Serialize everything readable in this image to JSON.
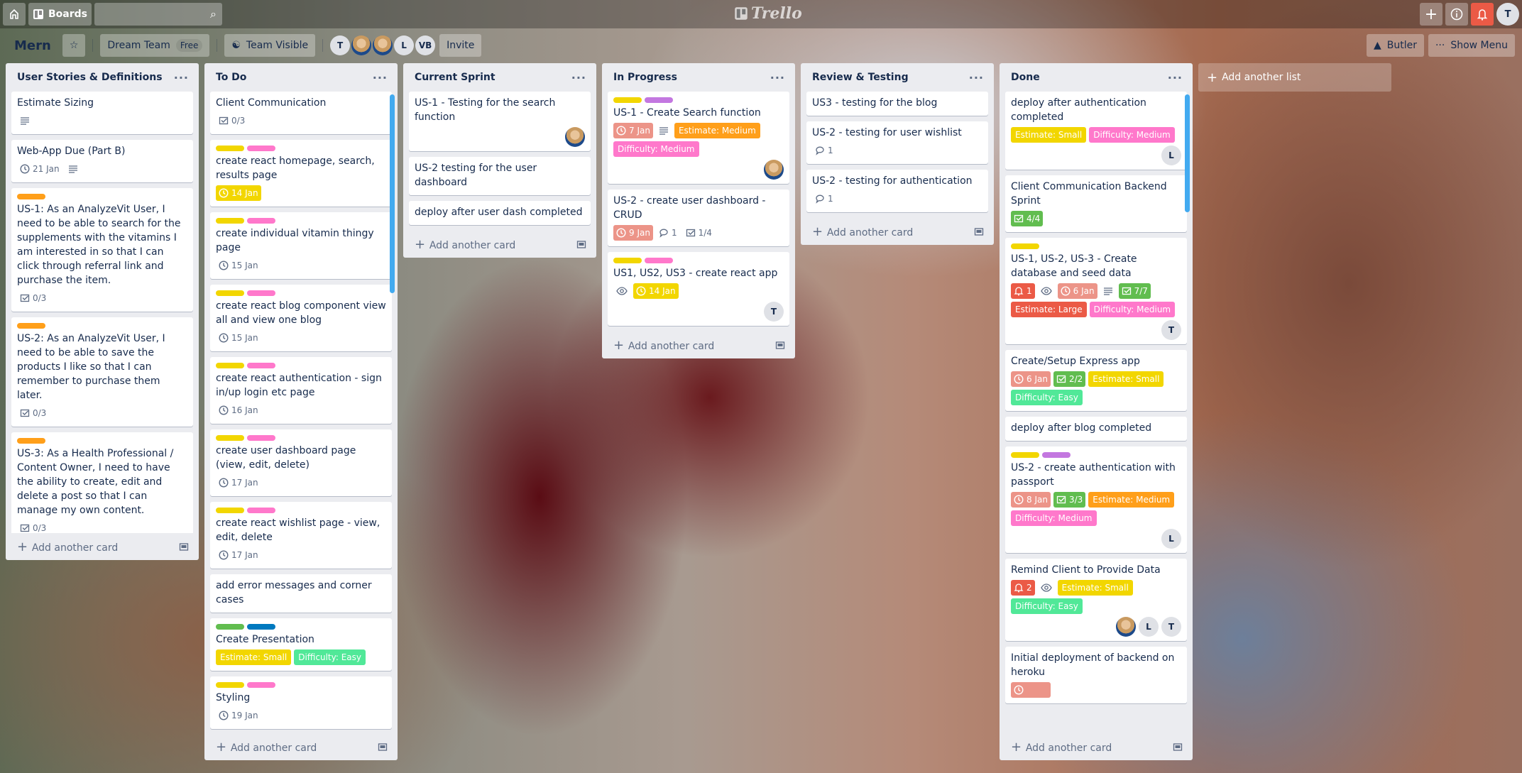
{
  "topbar": {
    "boards_label": "Boards",
    "logo": "Trello",
    "search_placeholder": "",
    "user_initial": "T",
    "icons": [
      "home-icon",
      "boards-icon",
      "search-icon",
      "plus-icon",
      "info-icon",
      "bell-icon"
    ],
    "notification_color": "#eb5a46"
  },
  "board": {
    "title": "Mern",
    "team": "Dream Team",
    "team_plan": "Free",
    "visibility": "Team Visible",
    "members": [
      {
        "initial": "T"
      },
      {
        "photo": true
      },
      {
        "photo": true
      },
      {
        "initial": "L"
      },
      {
        "initial": "VB"
      }
    ],
    "invite": "Invite",
    "butler": "Butler",
    "show_menu": "Show Menu"
  },
  "colors": {
    "yellow": "#f2d600",
    "pink": "#ff78cb",
    "orange": "#ff9f1a",
    "purple": "#c377e0",
    "green": "#61bd4f",
    "blue": "#0079bf",
    "red": "#eb5a46",
    "lime": "#51e898",
    "overdue": "#ec9488"
  },
  "add_card_label": "Add another card",
  "add_list_label": "Add another list",
  "lists": [
    {
      "name": "User Stories & Definitions",
      "cards": [
        {
          "title": "Estimate Sizing",
          "badges": [
            {
              "type": "description"
            }
          ]
        },
        {
          "title": "Web-App Due (Part B)",
          "badges": [
            {
              "type": "due",
              "text": "21 Jan"
            },
            {
              "type": "description"
            }
          ]
        },
        {
          "labels": [
            "orange"
          ],
          "title": "US-1: As an AnalyzeVit User, I need to be able to search for the supplements with the vitamins I am interested in so that I can click through referral link and purchase the item.",
          "badges": [
            {
              "type": "checklist",
              "text": "0/3"
            }
          ]
        },
        {
          "labels": [
            "orange"
          ],
          "title": "US-2: As an AnalyzeVit User, I need to be able to save the products I like so that I can remember to purchase them later.",
          "badges": [
            {
              "type": "checklist",
              "text": "0/3"
            }
          ]
        },
        {
          "labels": [
            "orange"
          ],
          "title": "US-3: As a Health Professional / Content Owner, I need to have the ability to create, edit and delete a post so that I can manage my own content.",
          "badges": [
            {
              "type": "checklist",
              "text": "0/3"
            }
          ]
        }
      ]
    },
    {
      "name": "To Do",
      "scroll": true,
      "cards": [
        {
          "title": "Client Communication",
          "badges": [
            {
              "type": "checklist",
              "text": "0/3"
            }
          ]
        },
        {
          "labels": [
            "yellow",
            "pink"
          ],
          "title": "create react homepage, search, results page",
          "badges": [
            {
              "type": "due",
              "text": "14 Jan",
              "color": "yellow"
            }
          ]
        },
        {
          "labels": [
            "yellow",
            "pink"
          ],
          "title": "create individual vitamin thingy page",
          "badges": [
            {
              "type": "due",
              "text": "15 Jan"
            }
          ]
        },
        {
          "labels": [
            "yellow",
            "pink"
          ],
          "title": "create react blog component view all and view one blog",
          "badges": [
            {
              "type": "due",
              "text": "15 Jan"
            }
          ]
        },
        {
          "labels": [
            "yellow",
            "pink"
          ],
          "title": "create react authentication - sign in/up login etc page",
          "badges": [
            {
              "type": "due",
              "text": "16 Jan"
            }
          ]
        },
        {
          "labels": [
            "yellow",
            "pink"
          ],
          "title": "create user dashboard page (view, edit, delete)",
          "badges": [
            {
              "type": "due",
              "text": "17 Jan"
            }
          ]
        },
        {
          "labels": [
            "yellow",
            "pink"
          ],
          "title": "create react wishlist page - view, edit, delete",
          "badges": [
            {
              "type": "due",
              "text": "17 Jan"
            }
          ]
        },
        {
          "title": "add error messages and corner cases"
        },
        {
          "labels": [
            "green",
            "blue"
          ],
          "title": "Create Presentation",
          "chips": [
            {
              "text": "Estimate: Small",
              "color": "yellow"
            },
            {
              "text": "Difficulty: Easy",
              "color": "lime"
            }
          ]
        },
        {
          "labels": [
            "yellow",
            "pink"
          ],
          "title": "Styling",
          "badges": [
            {
              "type": "due",
              "text": "19 Jan"
            }
          ]
        },
        {
          "labels": [
            "yellow",
            "red"
          ],
          "title": ""
        }
      ]
    },
    {
      "name": "Current Sprint",
      "cards": [
        {
          "title": "US-1 - Testing for the search function",
          "members": [
            {
              "photo": true
            }
          ]
        },
        {
          "title": "US-2 testing for the user dashboard"
        },
        {
          "title": "deploy after user dash completed"
        }
      ]
    },
    {
      "name": "In Progress",
      "cards": [
        {
          "labels": [
            "yellow",
            "purple"
          ],
          "title": "US-1 - Create Search function",
          "badges": [
            {
              "type": "due",
              "text": "7 Jan",
              "color": "overdue"
            },
            {
              "type": "description"
            }
          ],
          "chips": [
            {
              "text": "Estimate: Medium",
              "color": "orange"
            },
            {
              "text": "Difficulty: Medium",
              "color": "pink"
            }
          ],
          "members": [
            {
              "photo": true
            }
          ]
        },
        {
          "title": "US-2 - create user dashboard - CRUD",
          "badges": [
            {
              "type": "due",
              "text": "9 Jan",
              "color": "overdue"
            },
            {
              "type": "comments",
              "text": "1"
            },
            {
              "type": "checklist",
              "text": "1/4"
            }
          ]
        },
        {
          "labels": [
            "yellow",
            "pink"
          ],
          "title": "US1, US2, US3 - create react app",
          "badges": [
            {
              "type": "watch"
            },
            {
              "type": "due",
              "text": "14 Jan",
              "color": "yellow"
            }
          ],
          "members": [
            {
              "initial": "T"
            }
          ]
        }
      ]
    },
    {
      "name": "Review & Testing",
      "cards": [
        {
          "title": "US3 - testing for the blog"
        },
        {
          "title": "US-2 - testing for user wishlist",
          "badges": [
            {
              "type": "comments",
              "text": "1"
            }
          ]
        },
        {
          "title": "US-2 - testing for authentication",
          "badges": [
            {
              "type": "comments",
              "text": "1"
            }
          ]
        }
      ]
    },
    {
      "name": "Done",
      "scroll": true,
      "cards": [
        {
          "title": "deploy after authentication completed",
          "chips": [
            {
              "text": "Estimate: Small",
              "color": "yellow"
            },
            {
              "text": "Difficulty: Medium",
              "color": "pink"
            }
          ],
          "members": [
            {
              "initial": "L"
            }
          ]
        },
        {
          "title": "Client Communication Backend Sprint",
          "badges": [
            {
              "type": "checklist",
              "text": "4/4",
              "color": "green"
            }
          ]
        },
        {
          "labels": [
            "yellow"
          ],
          "title": "US-1, US-2, US-3 - Create database and seed data",
          "badges": [
            {
              "type": "notification",
              "text": "1",
              "color": "red"
            },
            {
              "type": "watch"
            },
            {
              "type": "due",
              "text": "6 Jan",
              "color": "overdue"
            },
            {
              "type": "description"
            },
            {
              "type": "checklist",
              "text": "7/7",
              "color": "green"
            }
          ],
          "chips": [
            {
              "text": "Estimate: Large",
              "color": "red"
            },
            {
              "text": "Difficulty: Medium",
              "color": "pink"
            }
          ],
          "members": [
            {
              "initial": "T"
            }
          ]
        },
        {
          "title": "Create/Setup Express app",
          "badges": [
            {
              "type": "due",
              "text": "6 Jan",
              "color": "overdue"
            },
            {
              "type": "checklist",
              "text": "2/2",
              "color": "green"
            }
          ],
          "chips": [
            {
              "text": "Estimate: Small",
              "color": "yellow"
            },
            {
              "text": "Difficulty: Easy",
              "color": "lime"
            }
          ]
        },
        {
          "title": "deploy after blog completed"
        },
        {
          "labels": [
            "yellow",
            "purple"
          ],
          "title": "US-2 - create authentication with passport",
          "badges": [
            {
              "type": "due",
              "text": "8 Jan",
              "color": "overdue"
            },
            {
              "type": "checklist",
              "text": "3/3",
              "color": "green"
            }
          ],
          "chips": [
            {
              "text": "Estimate: Medium",
              "color": "orange"
            },
            {
              "text": "Difficulty: Medium",
              "color": "pink"
            }
          ],
          "members": [
            {
              "initial": "L"
            }
          ]
        },
        {
          "title": "Remind Client to Provide Data",
          "badges": [
            {
              "type": "notification",
              "text": "2",
              "color": "red"
            },
            {
              "type": "watch"
            }
          ],
          "chips": [
            {
              "text": "Estimate: Small",
              "color": "yellow"
            },
            {
              "text": "Difficulty: Easy",
              "color": "lime"
            }
          ],
          "members": [
            {
              "photo": true
            },
            {
              "initial": "L"
            },
            {
              "initial": "T"
            }
          ]
        },
        {
          "title": "Initial deployment of backend on heroku",
          "badges": [
            {
              "type": "due",
              "text": "",
              "color": "overdue"
            }
          ]
        }
      ]
    }
  ]
}
